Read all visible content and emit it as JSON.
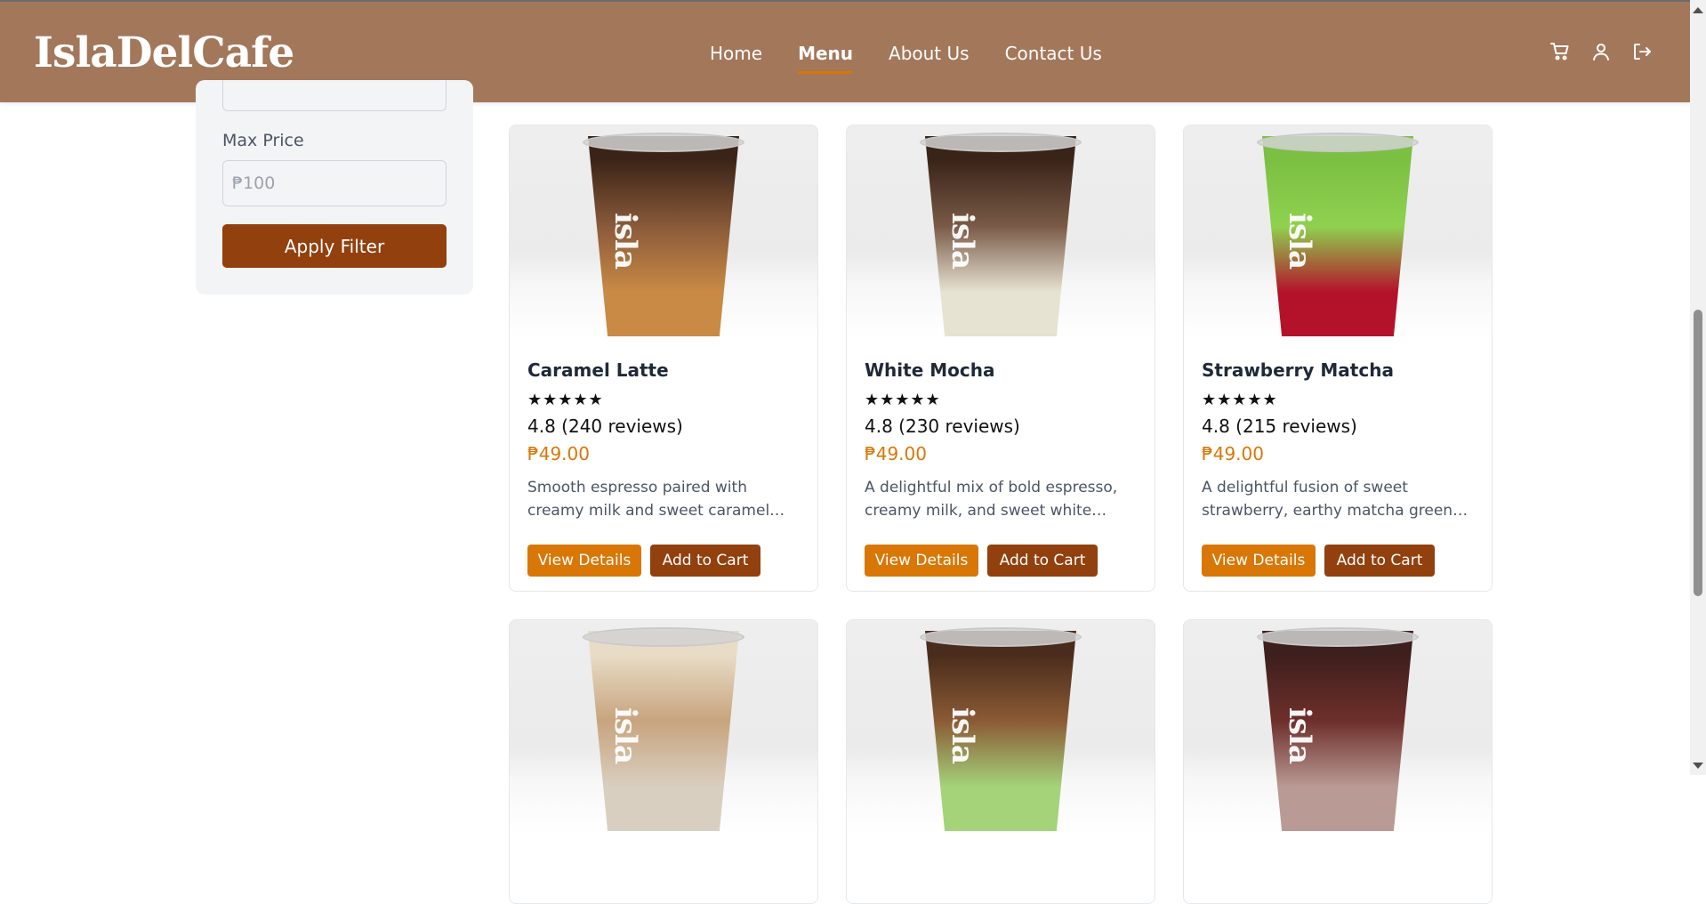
{
  "header": {
    "brand": "IslaDelCafe",
    "nav": [
      "Home",
      "Menu",
      "About Us",
      "Contact Us"
    ],
    "active_nav": "Menu",
    "icons": [
      "cart-icon",
      "user-icon",
      "logout-icon"
    ]
  },
  "sidebar": {
    "max_price_label": "Max Price",
    "max_price_placeholder": "₱100",
    "apply_button": "Apply Filter"
  },
  "products": [
    {
      "name": "Caramel Latte",
      "stars": "★★★★★",
      "rating": "4.8 (240 reviews)",
      "price": "₱49.00",
      "description": "Smooth espresso paired with creamy milk and sweet caramel syrup, serv…",
      "view_label": "View Details",
      "cart_label": "Add to Cart",
      "colors": {
        "top": "#3b2417",
        "mid": "#8a5a3a",
        "bottom": "#c98a45"
      }
    },
    {
      "name": "White Mocha",
      "stars": "★★★★★",
      "rating": "4.8 (230 reviews)",
      "price": "₱49.00",
      "description": "A delightful mix of bold espresso, creamy milk, and sweet white…",
      "view_label": "View Details",
      "cart_label": "Add to Cart",
      "colors": {
        "top": "#3a2418",
        "mid": "#7a5a47",
        "bottom": "#e7e3d3"
      }
    },
    {
      "name": "Strawberry Matcha",
      "stars": "★★★★★",
      "rating": "4.8 (215 reviews)",
      "price": "₱49.00",
      "description": "A delightful fusion of sweet strawberry, earthy matcha green te…",
      "view_label": "View Details",
      "cart_label": "Add to Cart",
      "colors": {
        "top": "#7cc043",
        "mid": "#8fd14f",
        "bottom": "#b3122a"
      }
    },
    {
      "name": "",
      "colors": {
        "top": "#e8dcc6",
        "mid": "#c8a47e",
        "bottom": "#d9cfc0"
      }
    },
    {
      "name": "",
      "colors": {
        "top": "#4a2c1c",
        "mid": "#8b5a35",
        "bottom": "#a4d37a"
      }
    },
    {
      "name": "",
      "colors": {
        "top": "#3d1f1d",
        "mid": "#6e2f2b",
        "bottom": "#b99a94"
      }
    }
  ],
  "cup_logo_text": "isla"
}
